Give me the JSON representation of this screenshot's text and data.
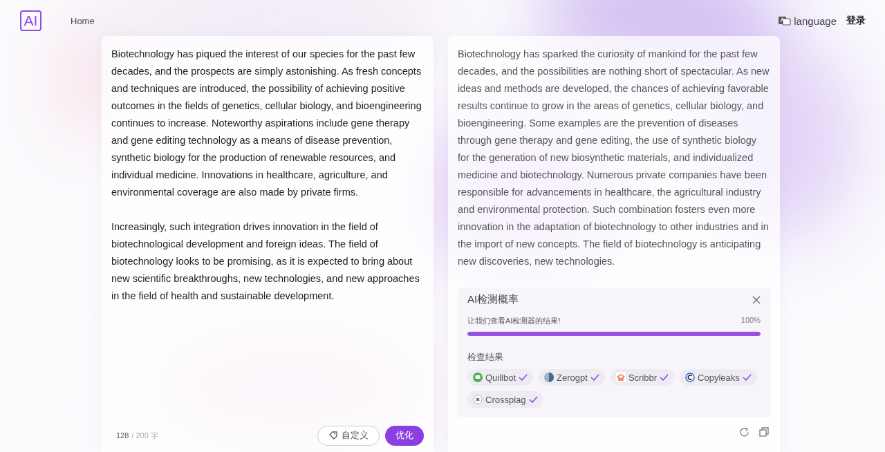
{
  "header": {
    "logo": "AI",
    "nav": [
      "Home"
    ],
    "language": "language",
    "login": "登录"
  },
  "input_panel": {
    "paragraphs": [
      "Biotechnology has piqued the interest of our species for the past few decades, and the prospects are simply astonishing. As fresh concepts and techniques are introduced, the possibility of achieving positive outcomes in the fields of genetics, cellular biology, and bioengineering continues to increase. Noteworthy aspirations include gene therapy and gene editing technology as a means of disease prevention, synthetic biology for the production of renewable resources, and individual medicine. Innovations in healthcare, agriculture, and environmental coverage are also made by private firms.",
      "Increasingly, such integration drives innovation in the field of biotechnological development and foreign ideas. The field of biotechnology looks to be promising, as it is expected to bring about new scientific breakthroughs, new technologies, and new approaches in the field of health and sustainable development."
    ],
    "count": "128",
    "limit": "/ 200 字",
    "buttons": [
      {
        "kind": "outline",
        "label": "自定义"
      },
      {
        "kind": "primary",
        "label": "优化"
      }
    ]
  },
  "output_panel": {
    "paragraphs": [
      "Biotechnology has sparked the curiosity of mankind for the past few decades, and the possibilities are nothing short of spectacular. As new ideas and methods are developed, the chances of achieving favorable results continue to grow in the areas of genetics, cellular biology, and bioengineering. Some examples are the prevention of diseases through gene therapy and gene editing, the use of synthetic biology for the generation of new biosynthetic materials, and individualized medicine and biotechnology. Numerous private companies have been responsible for advancements in healthcare, the agricultural industry and environmental protection. Such combination fosters even more innovation in the adaptation of biotechnology to other industries and in the import of new concepts. The field of biotechnology is anticipating new discoveries, new technologies."
    ],
    "detection": {
      "title": "AI检测概率",
      "subtitle": "让我们查看AI检测器的结果!",
      "reading": "100%",
      "level": 1,
      "results_title": "检查结果",
      "detectors": [
        {
          "name": "Quillbot",
          "checked": true
        },
        {
          "name": "Zerogpt",
          "checked": true
        },
        {
          "name": "Scribbr",
          "checked": true
        },
        {
          "name": "Copyleaks",
          "checked": true
        },
        {
          "name": "Crossplag",
          "checked": true
        }
      ]
    }
  }
}
